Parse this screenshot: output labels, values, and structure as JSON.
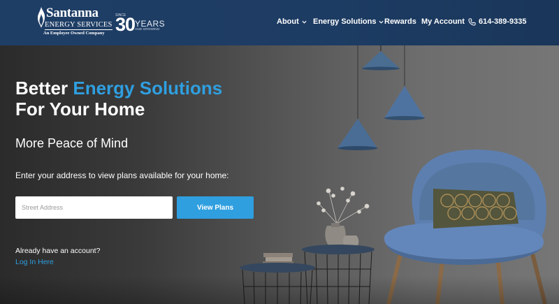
{
  "header": {
    "logo": {
      "brand": "Santanna",
      "brand_sub": "ENERGY SERVICES",
      "tagline": "An Employee Owned Company",
      "since": "SINCE",
      "thirty": "30",
      "years": "YEARS",
      "growing": "AND GROWING"
    },
    "nav": {
      "about": "About",
      "energy_solutions": "Energy Solutions",
      "rewards": "Rewards",
      "my_account": "My Account",
      "phone": "614-389-9335"
    },
    "colors": {
      "background": "#1f3e66",
      "text": "#ffffff"
    }
  },
  "hero": {
    "headline_prefix": "Better ",
    "headline_accent": "Energy Solutions",
    "headline_line2": "For Your Home",
    "subhead": "More Peace of Mind",
    "prompt": "Enter your address to view plans available for your home:",
    "address_placeholder": "Street Address",
    "view_plans_label": "View Plans",
    "have_account": "Already have an account?",
    "login_link": "Log In Here",
    "colors": {
      "accent": "#2f9fe0",
      "text": "#ffffff"
    }
  },
  "icons": [
    "flame-icon",
    "chevron-down-icon",
    "phone-icon"
  ]
}
